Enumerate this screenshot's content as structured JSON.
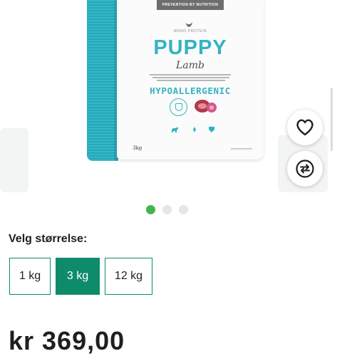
{
  "product_image": {
    "banner": "PREVENTION BY NUTRITION",
    "brand_line": "MONO PROTEIN",
    "title": "PUPPY",
    "flavor": "Lamb",
    "badge": "HYPOALLERGENIC",
    "weight": "3kg",
    "gusset_color": "#33b3c4"
  },
  "actions": {
    "favorite_icon": "heart-icon",
    "compare_icon": "compare-arrows-icon"
  },
  "carousel": {
    "total": 3,
    "active_index": 0,
    "active_color": "#43b649"
  },
  "size_selector": {
    "label": "Velg størrelse:",
    "options": [
      {
        "label": "1 kg",
        "selected": false
      },
      {
        "label": "3 kg",
        "selected": true
      },
      {
        "label": "12 kg",
        "selected": false
      }
    ],
    "accent": "#0e8b6a"
  },
  "price": {
    "text": "kr 369,00"
  }
}
